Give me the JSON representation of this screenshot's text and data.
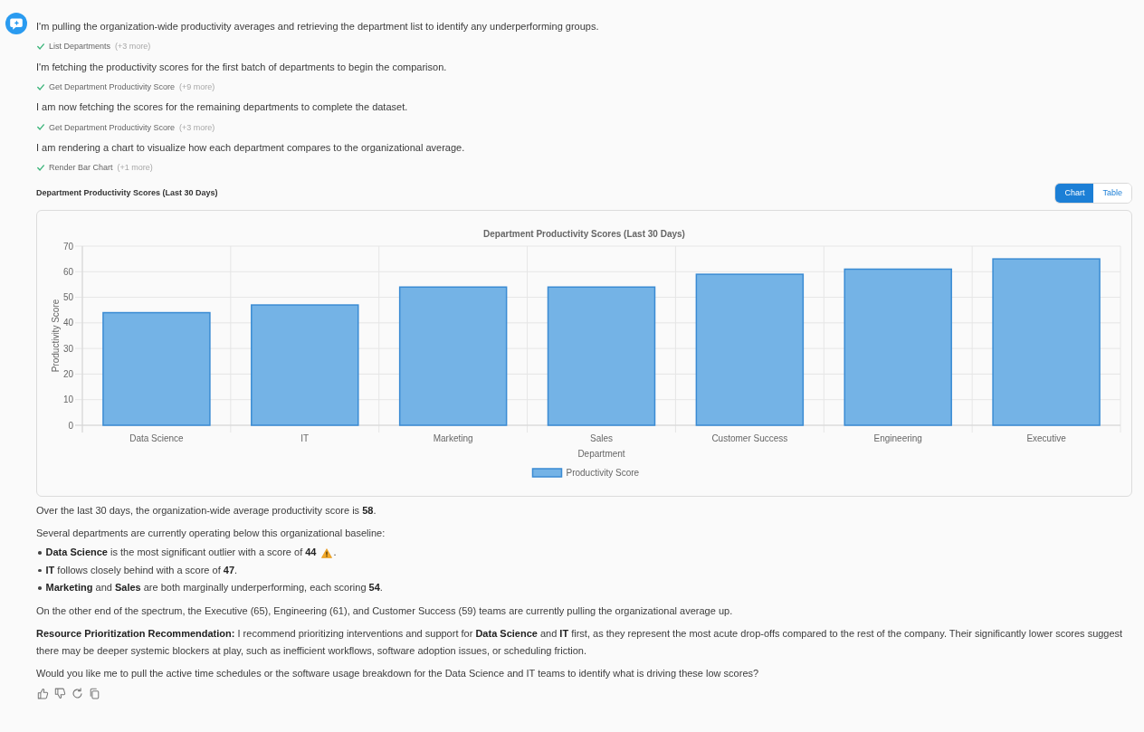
{
  "steps": [
    {
      "kind": "message",
      "text": "I'm pulling the organization-wide productivity averages and retrieving the department list to identify any underperforming groups."
    },
    {
      "kind": "tool_call",
      "label": "List Departments",
      "more": "(+3 more)",
      "done": true
    },
    {
      "kind": "message",
      "text": "I'm fetching the productivity scores for the first batch of departments to begin the comparison."
    },
    {
      "kind": "tool_call",
      "label": "Get Department Productivity Score",
      "more": "(+9 more)",
      "done": true
    },
    {
      "kind": "message",
      "text": "I am now fetching the scores for the remaining departments to complete the dataset."
    },
    {
      "kind": "tool_call",
      "label": "Get Department Productivity Score",
      "more": "(+3 more)",
      "done": true
    },
    {
      "kind": "message",
      "text": "I am rendering a chart to visualize how each department compares to the organizational average."
    },
    {
      "kind": "tool_call",
      "label": "Render Bar Chart",
      "more": "(+1 more)",
      "done": true
    }
  ],
  "chart_panel": {
    "heading": "Department Productivity Scores (Last 30 Days)",
    "view_toggle": [
      {
        "label": "Chart",
        "selected": true
      },
      {
        "label": "Table",
        "selected": false
      }
    ],
    "chart_data": {
      "type": "bar",
      "title": "Department Productivity Scores (Last 30 Days)",
      "xlabel": "Department",
      "ylabel": "Productivity Score",
      "categories": [
        "Data Science",
        "IT",
        "Marketing",
        "Sales",
        "Customer Success",
        "Engineering",
        "Executive"
      ],
      "series": [
        {
          "name": "Productivity Score",
          "color": "#74b3e6",
          "values": [
            44,
            47,
            54,
            54,
            59,
            61,
            65
          ]
        }
      ],
      "ylim": [
        0,
        70
      ],
      "yticks": [
        0,
        10,
        20,
        30,
        40,
        50,
        60,
        70
      ],
      "grid": true
    }
  },
  "response": [
    {
      "kind": "paragraph",
      "text": "Over the last 30 days, the organization-wide average productivity score is **58**."
    },
    {
      "kind": "paragraph",
      "text": "Several departments are currently operating below this organizational baseline:"
    },
    {
      "kind": "list",
      "items": [
        {
          "text": "**Data Science** is the most significant outlier with a score of **44**",
          "warning": true,
          "end": "."
        },
        {
          "text": "**IT** follows closely behind with a score of **47**.",
          "warning": false
        },
        {
          "text": "**Marketing** and **Sales** are both marginally underperforming, each scoring **54**.",
          "warning": false
        }
      ]
    },
    {
      "kind": "paragraph",
      "text": "On the other end of the spectrum, the Executive (65), Engineering (61), and Customer Success (59) teams are currently pulling the organizational average up."
    },
    {
      "kind": "paragraph",
      "text": "**Resource Prioritization Recommendation:** I recommend prioritizing interventions and support for **Data Science** and **IT** first, as they represent the most acute drop-offs compared to the rest of the company. Their significantly lower scores suggest there may be deeper systemic blockers at play, such as inefficient workflows, software adoption issues, or scheduling friction."
    },
    {
      "kind": "paragraph",
      "text": "Would you like me to pull the active time schedules or the software usage breakdown for the Data Science and IT teams to identify what is driving these low scores?"
    }
  ]
}
